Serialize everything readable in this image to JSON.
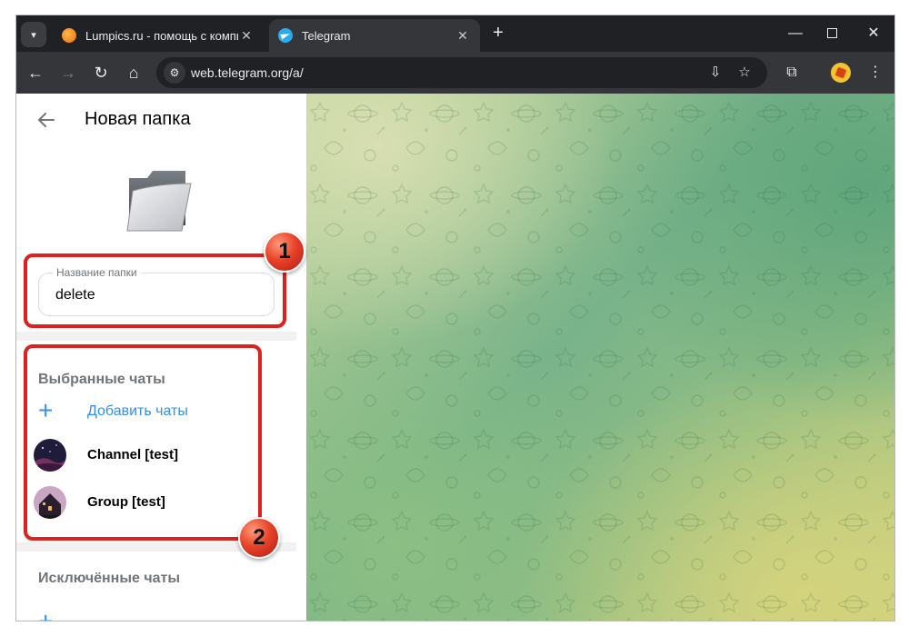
{
  "browser": {
    "tabs": [
      {
        "title": "Lumpics.ru - помощь с компьютером",
        "favicon": "lumpics-favicon",
        "active": false
      },
      {
        "title": "Telegram",
        "favicon": "telegram-favicon",
        "active": true
      }
    ],
    "new_tab_icon": "plus-icon",
    "window_controls": [
      "minimize-icon",
      "maximize-icon",
      "close-icon"
    ],
    "url": "web.telegram.org/a/",
    "toolbar_icons": [
      "back-arrow-icon",
      "forward-arrow-icon",
      "reload-icon",
      "home-icon",
      "site-settings-icon",
      "install-app-icon",
      "star-icon",
      "extensions-icon",
      "profile-avatar",
      "more-menu-icon"
    ]
  },
  "sidebar": {
    "header": {
      "back_icon": "arrow-left-icon",
      "title": "Новая папка"
    },
    "folder_icon": "folder-icon",
    "name_field": {
      "label": "Название папки",
      "value": "delete"
    },
    "included": {
      "title": "Выбранные чаты",
      "add_label": "Добавить чаты",
      "chats": [
        {
          "name": "Channel [test]",
          "avatar": "night-sky-avatar"
        },
        {
          "name": "Group [test]",
          "avatar": "house-avatar"
        }
      ]
    },
    "excluded": {
      "title": "Исключённые чаты"
    }
  },
  "annotations": {
    "badges": [
      "1",
      "2"
    ],
    "color": "#e0201c"
  },
  "colors": {
    "accent": "#3390ec",
    "browser_dark": "#202124",
    "toolbar": "#35363a"
  }
}
